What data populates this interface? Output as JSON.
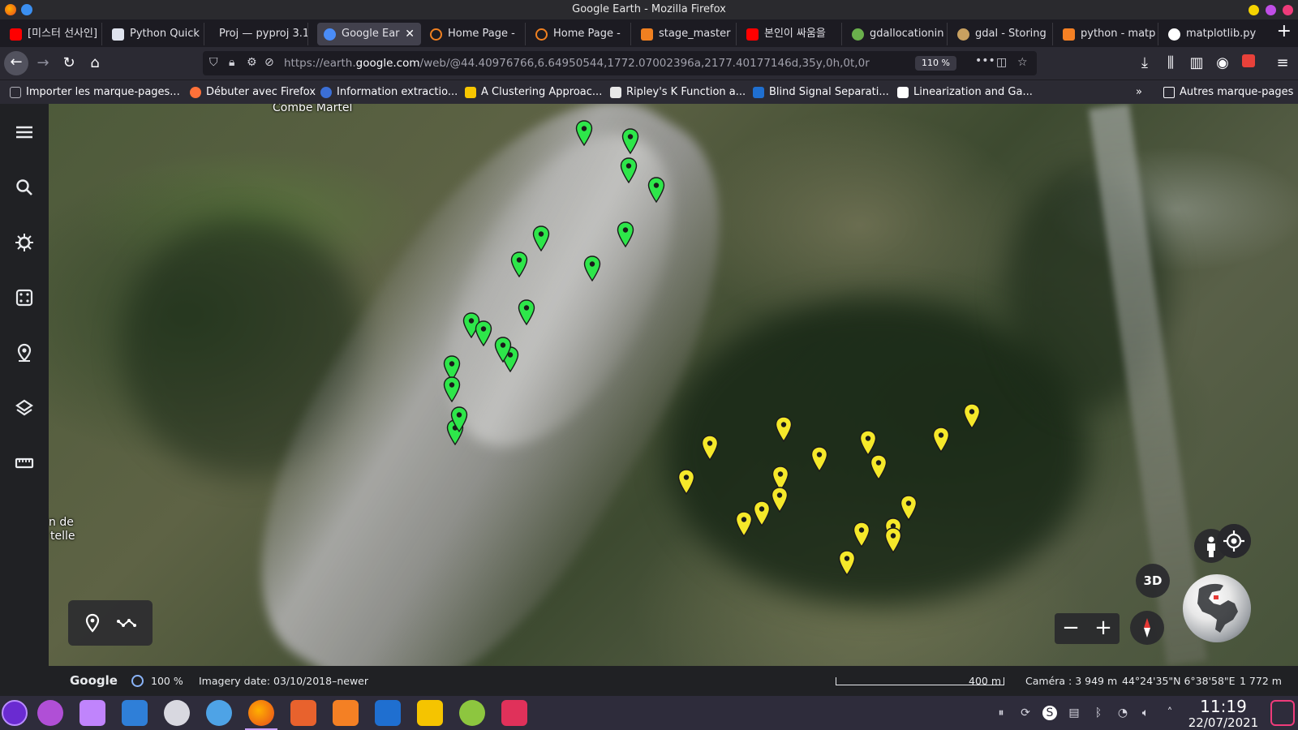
{
  "window": {
    "title": "Google Earth - Mozilla Firefox"
  },
  "tabs": [
    {
      "label": "[미스터 선사인] ",
      "icon": "youtube-icon",
      "color": "#ff0000"
    },
    {
      "label": "Python Quick",
      "icon": "document-icon",
      "color": "#ffffff"
    },
    {
      "label": "Proj — pyproj 3.1",
      "icon": "none",
      "color": "#ffffff"
    },
    {
      "label": "Google Ear",
      "icon": "google-earth-icon",
      "color": "#4a8cf7",
      "active": true
    },
    {
      "label": "Home Page - ",
      "icon": "ring-icon",
      "color": "#f08020"
    },
    {
      "label": "Home Page - ",
      "icon": "ring-icon",
      "color": "#f08020"
    },
    {
      "label": "stage_master",
      "icon": "overleaf-icon",
      "color": "#f08020"
    },
    {
      "label": "본인이 싸움을 ",
      "icon": "youtube-icon",
      "color": "#ff0000"
    },
    {
      "label": "gdallocationin",
      "icon": "globe-icon",
      "color": "#6ab04c"
    },
    {
      "label": "gdal - Storing",
      "icon": "gis-icon",
      "color": "#c8a060"
    },
    {
      "label": "python - matp",
      "icon": "stack-icon",
      "color": "#f48024"
    },
    {
      "label": "matplotlib.py",
      "icon": "matplotlib-icon",
      "color": "#ffffff"
    }
  ],
  "navbar": {
    "url_prefix": "https://earth.",
    "url_domain": "google.com",
    "url_path": "/web/@44.40976766,6.64950544,1772.07002396a,2177.40177146d,35y,0h,0t,0r",
    "zoom": "110 %"
  },
  "bookmarks": [
    {
      "label": "Importer les marque-pages...",
      "color": "#b0b0b8"
    },
    {
      "label": "Débuter avec Firefox",
      "color": "#ff7139"
    },
    {
      "label": "Information extractio...",
      "color": "#3b6fd6"
    },
    {
      "label": "A Clustering Approac...",
      "color": "#f7c600"
    },
    {
      "label": "Ripley's K Function a...",
      "color": "#ffffff"
    },
    {
      "label": "Blind Signal Separati...",
      "color": "#1f6fd0"
    },
    {
      "label": "Linearization and Ga...",
      "color": "#ffffff"
    }
  ],
  "bookmarks_other": "Autres marque-pages",
  "map": {
    "labels": {
      "combe_martel": "Combe Martel",
      "left_edge_line1": "n de",
      "left_edge_line2": "telle"
    },
    "green_pin_count": 17,
    "yellow_pin_count": 17,
    "green_color": "#2ee64a",
    "yellow_color": "#f5e82a",
    "view_toggle": "3D"
  },
  "status": {
    "brand": "Google",
    "load_percent": "100 %",
    "imagery_date": "Imagery date: 03/10/2018–newer",
    "scale": "400 m",
    "camera": "Caméra : 3 949 m",
    "coordinates": "44°24'35\"N 6°38'58\"E",
    "elevation": "1 772 m"
  },
  "taskbar": {
    "time": "11:19",
    "date": "22/07/2021"
  }
}
